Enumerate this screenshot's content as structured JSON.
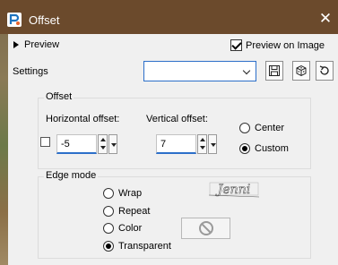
{
  "window": {
    "title": "Offset",
    "close_glyph": "✕"
  },
  "preview": {
    "label": "Preview",
    "preview_on_image_label": "Preview on Image",
    "preview_on_image_checked": true
  },
  "settings": {
    "label": "Settings",
    "selected_value": ""
  },
  "offset": {
    "legend": "Offset",
    "horizontal_label": "Horizontal offset:",
    "horizontal_value": "-5",
    "vertical_label": "Vertical offset:",
    "vertical_value": "7",
    "link_checked": false,
    "mode_options": [
      {
        "label": "Center",
        "checked": false
      },
      {
        "label": "Custom",
        "checked": true
      }
    ]
  },
  "edge_mode": {
    "legend": "Edge mode",
    "options": [
      {
        "label": "Wrap",
        "checked": false
      },
      {
        "label": "Repeat",
        "checked": false
      },
      {
        "label": "Color",
        "checked": false
      },
      {
        "label": "Transparent",
        "checked": true
      }
    ],
    "watermark_text": "Jenni"
  },
  "colors": {
    "title_bar": "#6b4a2c",
    "client_bg": "#f0f0f0",
    "accent": "#2c6fc9"
  }
}
